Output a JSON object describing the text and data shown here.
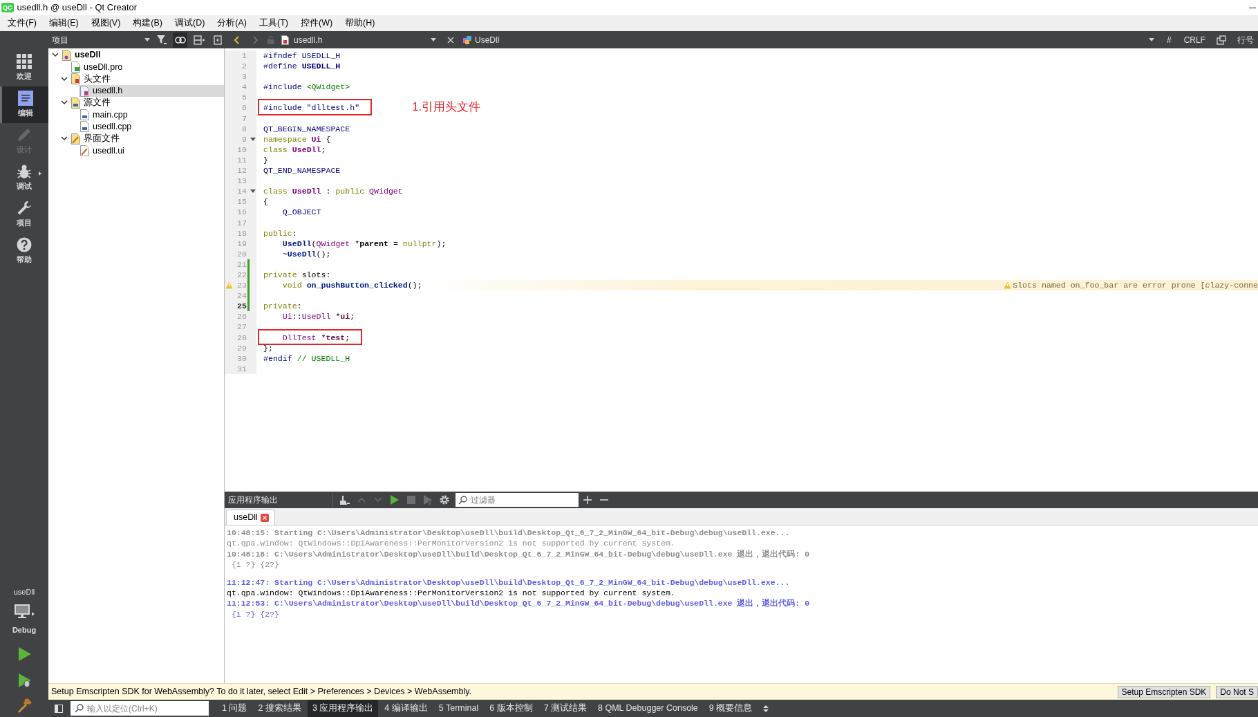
{
  "window": {
    "logo_text": "QC",
    "title": "usedll.h @ useDll - Qt Creator"
  },
  "menu": [
    "文件(F)",
    "编辑(E)",
    "视图(V)",
    "构建(B)",
    "调试(D)",
    "分析(A)",
    "工具(T)",
    "控件(W)",
    "帮助(H)"
  ],
  "mode_bar": {
    "items": [
      {
        "label": "欢迎",
        "kind": "welcome",
        "selected": false,
        "disabled": false
      },
      {
        "label": "编辑",
        "kind": "edit",
        "selected": true,
        "disabled": false
      },
      {
        "label": "设计",
        "kind": "design",
        "selected": false,
        "disabled": true
      },
      {
        "label": "调试",
        "kind": "debug",
        "selected": false,
        "disabled": false,
        "menu_arrow": true
      },
      {
        "label": "项目",
        "kind": "projects",
        "selected": false,
        "disabled": false
      },
      {
        "label": "帮助",
        "kind": "help",
        "selected": false,
        "disabled": false
      }
    ],
    "project_label": "useDll",
    "build_config": "Debug"
  },
  "project_pane": {
    "title": "项目",
    "link_with_editor": true,
    "tree": [
      {
        "label": "useDll",
        "kind": "project",
        "expanded": true,
        "selected": false,
        "children": [
          {
            "label": "useDll.pro",
            "kind": "pro",
            "selected": false
          },
          {
            "label": "头文件",
            "kind": "header-folder",
            "expanded": true,
            "selected": false,
            "children": [
              {
                "label": "usedll.h",
                "kind": "header",
                "selected": true
              }
            ]
          },
          {
            "label": "源文件",
            "kind": "source-folder",
            "expanded": true,
            "selected": false,
            "children": [
              {
                "label": "main.cpp",
                "kind": "source",
                "selected": false
              },
              {
                "label": "usedll.cpp",
                "kind": "source",
                "selected": false
              }
            ]
          },
          {
            "label": "界面文件",
            "kind": "form-folder",
            "expanded": true,
            "selected": false,
            "children": [
              {
                "label": "usedll.ui",
                "kind": "form",
                "selected": false
              }
            ]
          }
        ]
      }
    ]
  },
  "editor_toolbar": {
    "back_enabled": true,
    "forward_enabled": false,
    "file": "usedll.h",
    "symbol": "UseDll",
    "indicators": [
      "#",
      "CRLF"
    ],
    "line_label": "行号"
  },
  "code_lines": [
    {
      "num": "1",
      "tokens": [
        {
          "kind": "pre",
          "text": "#ifndef"
        },
        {
          "kind": "macro",
          "text": " USEDLL_H"
        }
      ]
    },
    {
      "num": "2",
      "tokens": [
        {
          "kind": "pre",
          "text": "#define"
        },
        {
          "kind": "macro-bold",
          "text": " USEDLL_H"
        }
      ]
    },
    {
      "num": "3"
    },
    {
      "num": "4",
      "tokens": [
        {
          "kind": "pre",
          "text": "#include"
        },
        {
          "kind": "string",
          "text": " <QWidget>"
        }
      ]
    },
    {
      "num": "5"
    },
    {
      "num": "6",
      "boxed": true,
      "note": "1.引用头文件",
      "tokens": [
        {
          "kind": "pre",
          "text": "#include \"dlltest.h\""
        }
      ]
    },
    {
      "num": "7"
    },
    {
      "num": "8",
      "tokens": [
        {
          "kind": "macro",
          "text": "QT_BEGIN_NAMESPACE"
        }
      ]
    },
    {
      "num": "9",
      "fold": true,
      "tokens": [
        {
          "kind": "keyword",
          "text": "namespace"
        },
        {
          "kind": "type-bold",
          "text": " Ui"
        },
        {
          "kind": "plain",
          "text": " {"
        }
      ]
    },
    {
      "num": "10",
      "tokens": [
        {
          "kind": "keyword",
          "text": "class"
        },
        {
          "kind": "type-bold",
          "text": " UseDll"
        },
        {
          "kind": "plain",
          "text": ";"
        }
      ]
    },
    {
      "num": "11",
      "tokens": [
        {
          "kind": "plain",
          "text": "}"
        }
      ]
    },
    {
      "num": "12",
      "tokens": [
        {
          "kind": "macro",
          "text": "QT_END_NAMESPACE"
        }
      ]
    },
    {
      "num": "13"
    },
    {
      "num": "14",
      "fold": true,
      "tokens": [
        {
          "kind": "keyword",
          "text": "class"
        },
        {
          "kind": "type-bold",
          "text": " UseDll"
        },
        {
          "kind": "plain",
          "text": " : "
        },
        {
          "kind": "keyword",
          "text": "public"
        },
        {
          "kind": "type",
          "text": " QWidget"
        }
      ]
    },
    {
      "num": "15",
      "tokens": [
        {
          "kind": "plain",
          "text": "{"
        }
      ]
    },
    {
      "num": "16",
      "tokens": [
        {
          "kind": "macro",
          "text": "    Q_OBJECT"
        }
      ]
    },
    {
      "num": "17"
    },
    {
      "num": "18",
      "tokens": [
        {
          "kind": "keyword",
          "text": "public"
        },
        {
          "kind": "plain",
          "text": ":"
        }
      ]
    },
    {
      "num": "19",
      "tokens": [
        {
          "kind": "func-bold",
          "text": "    UseDll"
        },
        {
          "kind": "plain",
          "text": "("
        },
        {
          "kind": "type",
          "text": "QWidget"
        },
        {
          "kind": "plain",
          "text": " *"
        },
        {
          "kind": "plain-bold",
          "text": "parent"
        },
        {
          "kind": "plain",
          "text": " = "
        },
        {
          "kind": "keyword",
          "text": "nullptr"
        },
        {
          "kind": "plain",
          "text": ");"
        }
      ]
    },
    {
      "num": "20",
      "tokens": [
        {
          "kind": "plain",
          "text": "    ~"
        },
        {
          "kind": "func-bold",
          "text": "UseDll"
        },
        {
          "kind": "plain",
          "text": "();"
        }
      ]
    },
    {
      "num": "21",
      "modified": true
    },
    {
      "num": "22",
      "modified": true,
      "tokens": [
        {
          "kind": "keyword",
          "text": "private"
        },
        {
          "kind": "plain",
          "text": " slots:"
        }
      ]
    },
    {
      "num": "23",
      "modified": true,
      "warning": "Slots named on_foo_bar are error prone [clazy-conne",
      "tokens": [
        {
          "kind": "keyword",
          "text": "    void"
        },
        {
          "kind": "func-bold",
          "text": " on_pushButton_clicked"
        },
        {
          "kind": "plain",
          "text": "();"
        }
      ]
    },
    {
      "num": "24",
      "modified": true
    },
    {
      "num": "25",
      "modified": true,
      "current": true,
      "tokens": [
        {
          "kind": "keyword",
          "text": "private"
        },
        {
          "kind": "plain",
          "text": ":"
        }
      ]
    },
    {
      "num": "26",
      "tokens": [
        {
          "kind": "type",
          "text": "    Ui"
        },
        {
          "kind": "plain",
          "text": "::"
        },
        {
          "kind": "type",
          "text": "UseDll"
        },
        {
          "kind": "plain",
          "text": " *"
        },
        {
          "kind": "member-bold",
          "text": "ui"
        },
        {
          "kind": "plain",
          "text": ";"
        }
      ]
    },
    {
      "num": "27"
    },
    {
      "num": "28",
      "boxed": true,
      "tokens": [
        {
          "kind": "type",
          "text": "    DllTest"
        },
        {
          "kind": "plain",
          "text": " *"
        },
        {
          "kind": "member-bold",
          "text": "test"
        },
        {
          "kind": "plain",
          "text": ";"
        }
      ]
    },
    {
      "num": "29",
      "tokens": [
        {
          "kind": "plain",
          "text": "};"
        }
      ]
    },
    {
      "num": "30",
      "tokens": [
        {
          "kind": "pre",
          "text": "#endif"
        },
        {
          "kind": "comment",
          "text": " // USEDLL_H"
        }
      ]
    },
    {
      "num": "31"
    }
  ],
  "output_pane": {
    "title": "应用程序输出",
    "filter_placeholder": "过滤器",
    "tabs": [
      {
        "label": "useDll",
        "selected": true
      }
    ],
    "lines": [
      {
        "kind": "status-old",
        "text": "10:48:15: Starting C:\\Users\\Administrator\\Desktop\\useDll\\build\\Desktop_Qt_6_7_2_MinGW_64_bit-Debug\\debug\\useDll.exe..."
      },
      {
        "kind": "output-old",
        "text": "qt.qpa.window: QtWindows::DpiAwareness::PerMonitorVersion2 is not supported by current system."
      },
      {
        "kind": "status-old",
        "text": "10:48:18: C:\\Users\\Administrator\\Desktop\\useDll\\build\\Desktop_Qt_6_7_2_MinGW_64_bit-Debug\\debug\\useDll.exe 退出，退出代码: 0"
      },
      {
        "kind": "output-old",
        "text": " {1 ?} {2?}"
      },
      {
        "kind": "status",
        "gap_before": true,
        "text": "11:12:47: Starting C:\\Users\\Administrator\\Desktop\\useDll\\build\\Desktop_Qt_6_7_2_MinGW_64_bit-Debug\\debug\\useDll.exe..."
      },
      {
        "kind": "stderr",
        "text": "qt.qpa.window: QtWindows::DpiAwareness::PerMonitorVersion2 is not supported by current system."
      },
      {
        "kind": "status",
        "text": "11:12:53: C:\\Users\\Administrator\\Desktop\\useDll\\build\\Desktop_Qt_6_7_2_MinGW_64_bit-Debug\\debug\\useDll.exe 退出，退出代码: 0"
      },
      {
        "kind": "output",
        "text": " {1 ?} {2?}"
      }
    ]
  },
  "info_bar": {
    "message": "Setup Emscripten SDK for WebAssembly? To do it later, select Edit > Preferences > Devices > WebAssembly.",
    "buttons": [
      "Setup Emscripten SDK",
      "Do Not S"
    ]
  },
  "status_bar": {
    "locator_placeholder": "输入以定位(Ctrl+K)",
    "panes": [
      {
        "label": "1 问题",
        "selected": false
      },
      {
        "label": "2 搜索结果",
        "selected": false
      },
      {
        "label": "3 应用程序输出",
        "selected": true
      },
      {
        "label": "4 编译输出",
        "selected": false
      },
      {
        "label": "5 Terminal",
        "selected": false
      },
      {
        "label": "6 版本控制",
        "selected": false
      },
      {
        "label": "7 测试结果",
        "selected": false
      },
      {
        "label": "8 QML Debugger Console",
        "selected": false
      },
      {
        "label": "9 概要信息",
        "selected": false
      }
    ]
  }
}
